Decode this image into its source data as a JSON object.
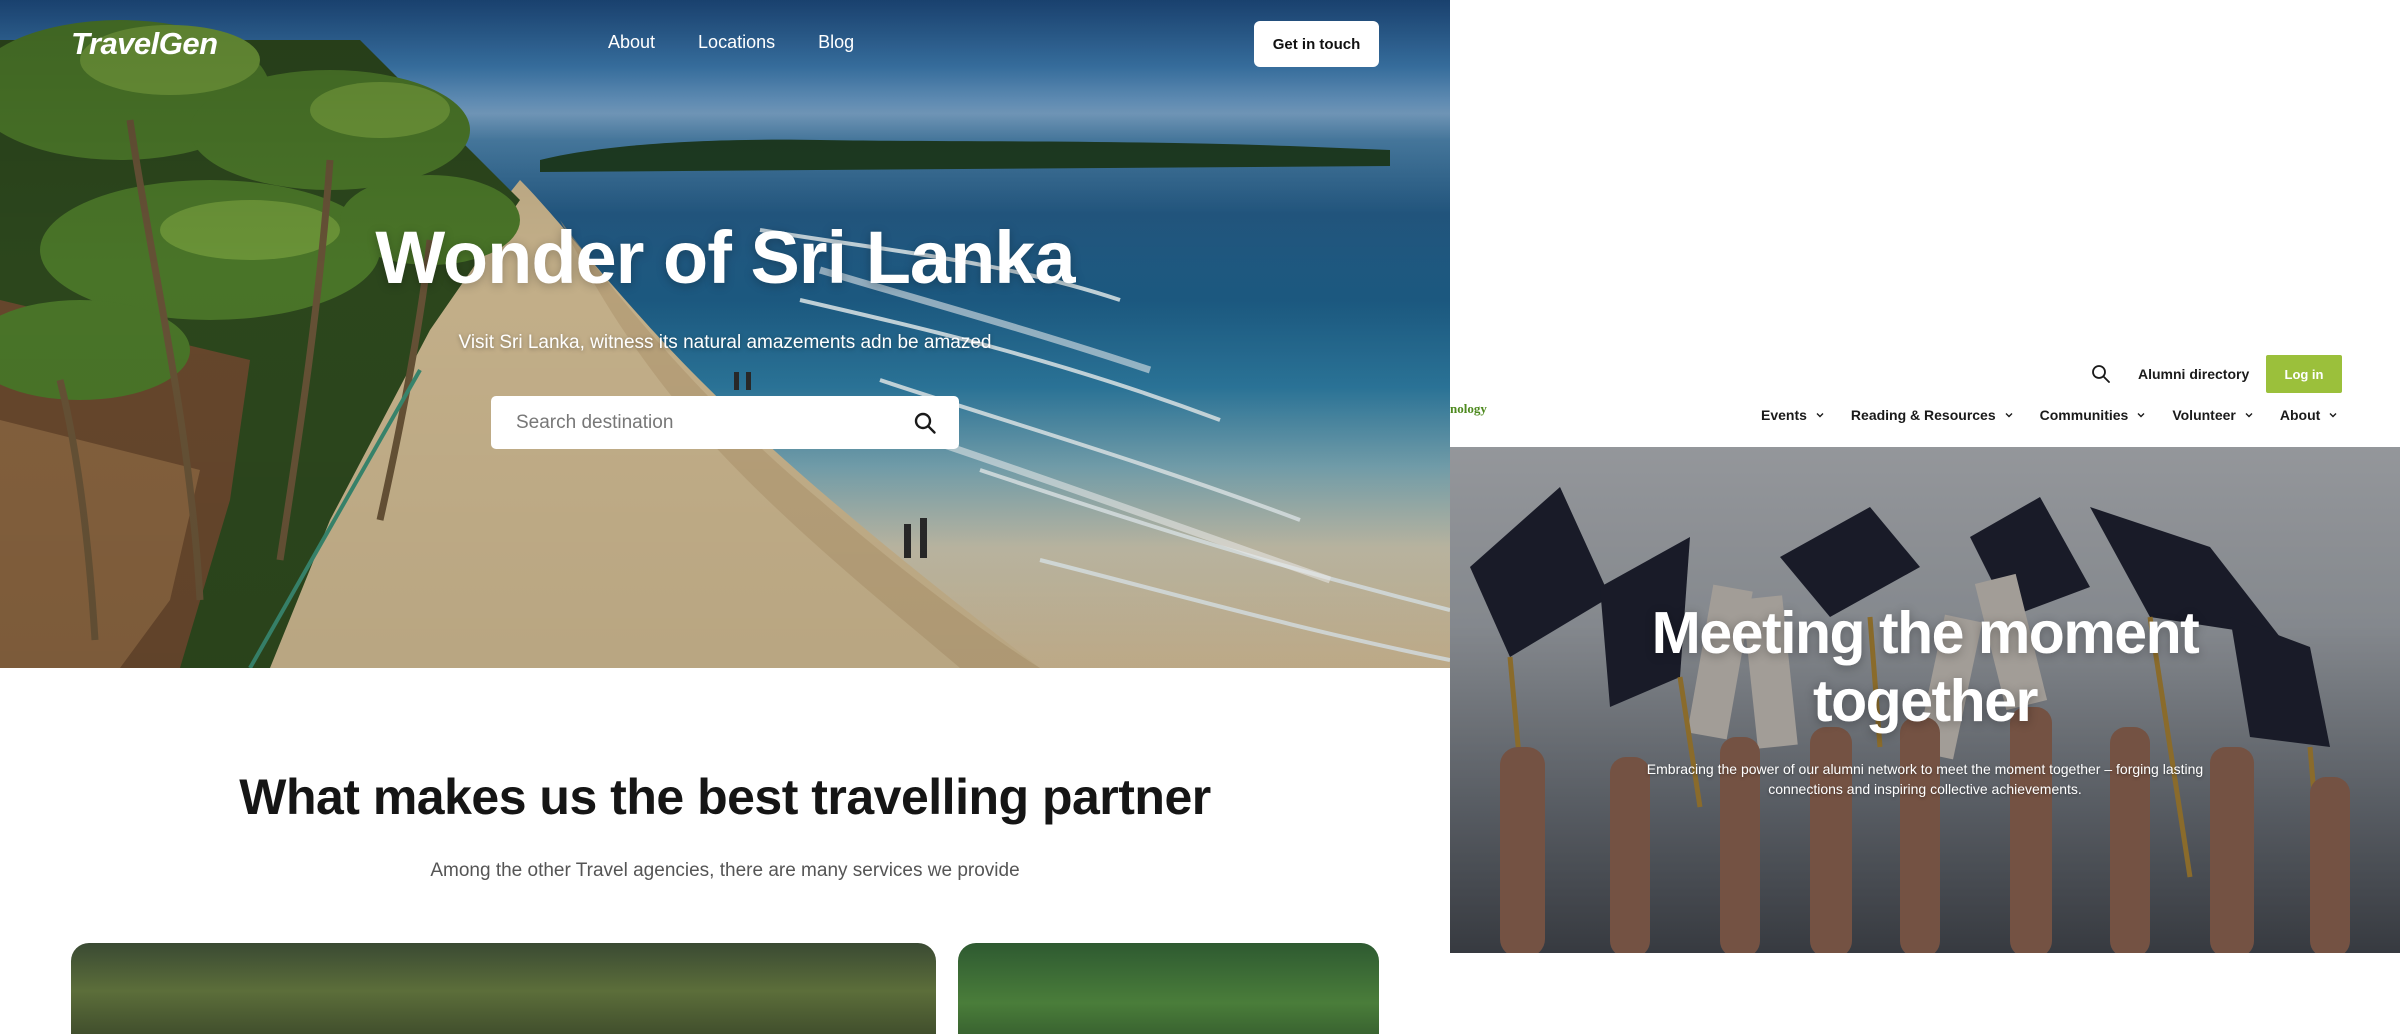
{
  "travelgen": {
    "logo": "TravelGen",
    "nav": [
      "About",
      "Locations",
      "Blog"
    ],
    "cta": "Get in touch",
    "hero_title": "Wonder of Sri Lanka",
    "hero_subtitle": "Visit Sri Lanka, witness its natural amazements adn be amazed",
    "search_placeholder": "Search destination",
    "section_title": "What makes us the best travelling partner",
    "section_subtitle": "Among the other Travel agencies, there are many services we provide"
  },
  "alumni": {
    "brand_fragment": "nology",
    "directory_link": "Alumni directory",
    "login_button": "Log in",
    "menu": [
      "Events",
      "Reading & Resources",
      "Communities",
      "Volunteer",
      "About"
    ],
    "hero_title_line1": "Meeting the moment",
    "hero_title_line2": "together",
    "hero_subtitle_line1": "Embracing the power of our alumni network to meet the moment together – forging lasting",
    "hero_subtitle_line2": "connections and inspiring collective achievements.",
    "accent_color": "#9bc03b"
  }
}
